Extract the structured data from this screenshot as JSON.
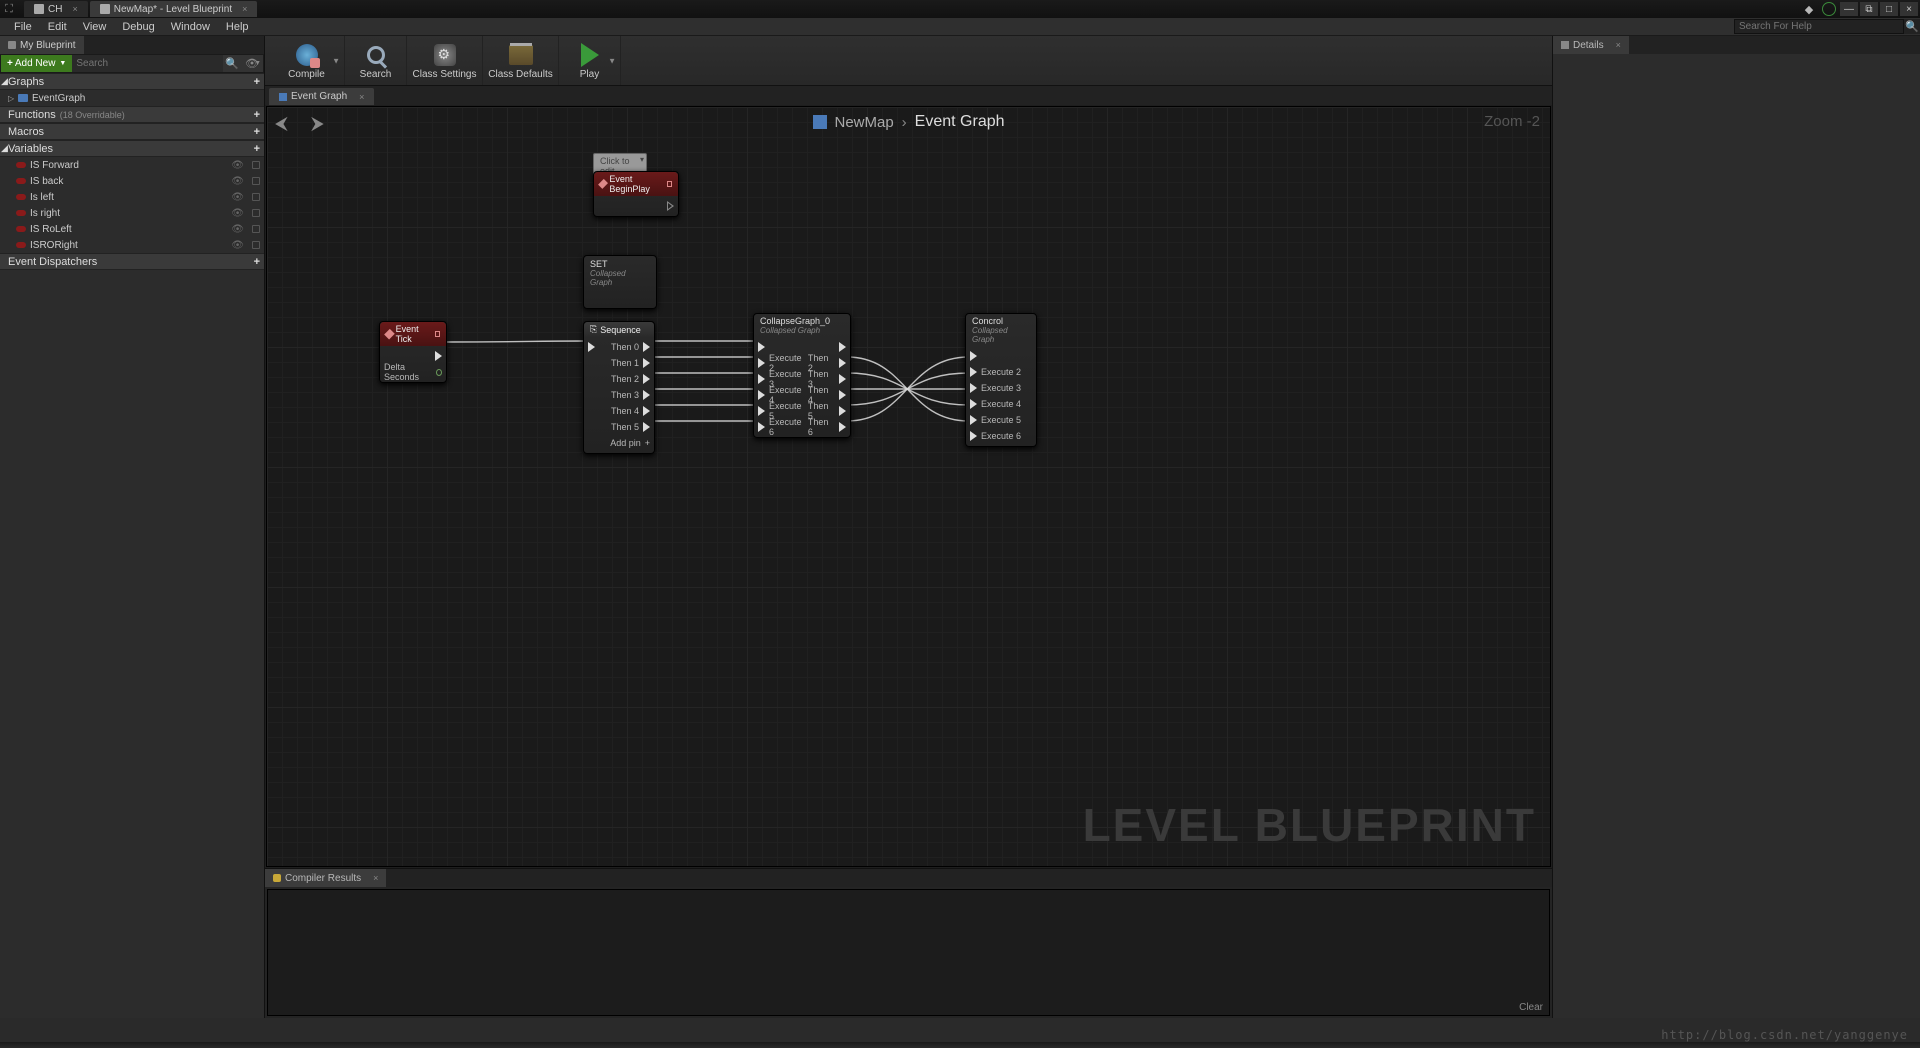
{
  "window": {
    "tabs": [
      {
        "label": "CH"
      },
      {
        "label": "NewMap* - Level Blueprint"
      }
    ],
    "controls": {
      "min": "—",
      "max": "□",
      "close": "×",
      "restore": "⧉"
    }
  },
  "menubar": {
    "items": [
      "File",
      "Edit",
      "View",
      "Debug",
      "Window",
      "Help"
    ],
    "search_placeholder": "Search For Help"
  },
  "left": {
    "tab": "My Blueprint",
    "add_new": "Add New",
    "search_placeholder": "Search",
    "sections": {
      "graphs": {
        "label": "Graphs",
        "items": [
          "EventGraph"
        ]
      },
      "functions": {
        "label": "Functions",
        "count_label": "(18 Overridable)"
      },
      "macros": {
        "label": "Macros"
      },
      "variables": {
        "label": "Variables",
        "items": [
          "IS Forward",
          "IS back",
          "Is left",
          "Is right",
          "IS RoLeft",
          "ISRORight"
        ]
      },
      "dispatchers": {
        "label": "Event Dispatchers"
      }
    }
  },
  "toolbar": {
    "compile": "Compile",
    "search": "Search",
    "settings": "Class Settings",
    "defaults": "Class Defaults",
    "play": "Play"
  },
  "graph": {
    "tab": "Event Graph",
    "breadcrumb_map": "NewMap",
    "breadcrumb_graph": "Event Graph",
    "zoom": "Zoom -2",
    "watermark": "LEVEL BLUEPRINT",
    "comment": "Click to edit",
    "nodes": {
      "beginplay": {
        "title": "Event BeginPlay"
      },
      "tick": {
        "title": "Event Tick",
        "out": "Delta Seconds"
      },
      "set": {
        "title": "SET",
        "sub": "Collapsed Graph"
      },
      "sequence": {
        "title": "Sequence",
        "pins": [
          "Then 0",
          "Then 1",
          "Then 2",
          "Then 3",
          "Then 4",
          "Then 5"
        ],
        "addpin": "Add pin"
      },
      "collapse": {
        "title": "CollapseGraph_0",
        "sub": "Collapsed Graph",
        "outs": [
          "Execute 2",
          "Execute 3",
          "Execute 4",
          "Execute 5",
          "Execute 6"
        ],
        "rights": [
          "Then 2",
          "Then 3",
          "Then 4",
          "Then 5",
          "Then 6"
        ]
      },
      "control": {
        "title": "Concrol",
        "sub": "Collapsed Graph",
        "outs": [
          "Execute 2",
          "Execute 3",
          "Execute 4",
          "Execute 5",
          "Execute 6"
        ]
      }
    }
  },
  "compiler": {
    "tab": "Compiler Results",
    "clear": "Clear"
  },
  "details": {
    "tab": "Details"
  },
  "url": "http://blog.csdn.net/yanggenye"
}
